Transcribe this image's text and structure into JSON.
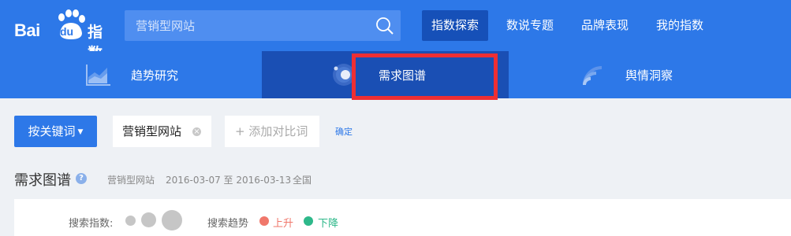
{
  "header": {
    "logo_text": "Bai",
    "logo_du": "du",
    "logo_suffix": "指数",
    "search": {
      "value": "营销型网站"
    },
    "nav": [
      {
        "label": "指数探索",
        "active": true
      },
      {
        "label": "数说专题",
        "active": false
      },
      {
        "label": "品牌表现",
        "active": false
      },
      {
        "label": "我的指数",
        "active": false
      }
    ]
  },
  "subnav": {
    "tabs": [
      {
        "label": "趋势研究",
        "icon": "trend-chart-icon",
        "active": false
      },
      {
        "label": "需求图谱",
        "icon": "demand-graph-icon",
        "active": true
      },
      {
        "label": "舆情洞察",
        "icon": "sentiment-signal-icon",
        "active": false
      }
    ]
  },
  "keywords": {
    "dropdown_label": "按关键词",
    "chip": "营销型网站",
    "add_compare": "+ 添加对比词",
    "confirm": "确定"
  },
  "section": {
    "title": "需求图谱",
    "keyword": "营销型网站",
    "date_range": "2016-03-07 至 2016-03-13",
    "region": "全国"
  },
  "legend": {
    "index_label": "搜索指数:",
    "trend_label": "搜索趋势",
    "up_label": "上升",
    "down_label": "下降",
    "up_color": "#f0776b",
    "down_color": "#2eb88a"
  },
  "colors": {
    "brand_blue": "#2d78e8",
    "active_dark": "#1a4fb4",
    "highlight_red": "#ee2f33"
  }
}
